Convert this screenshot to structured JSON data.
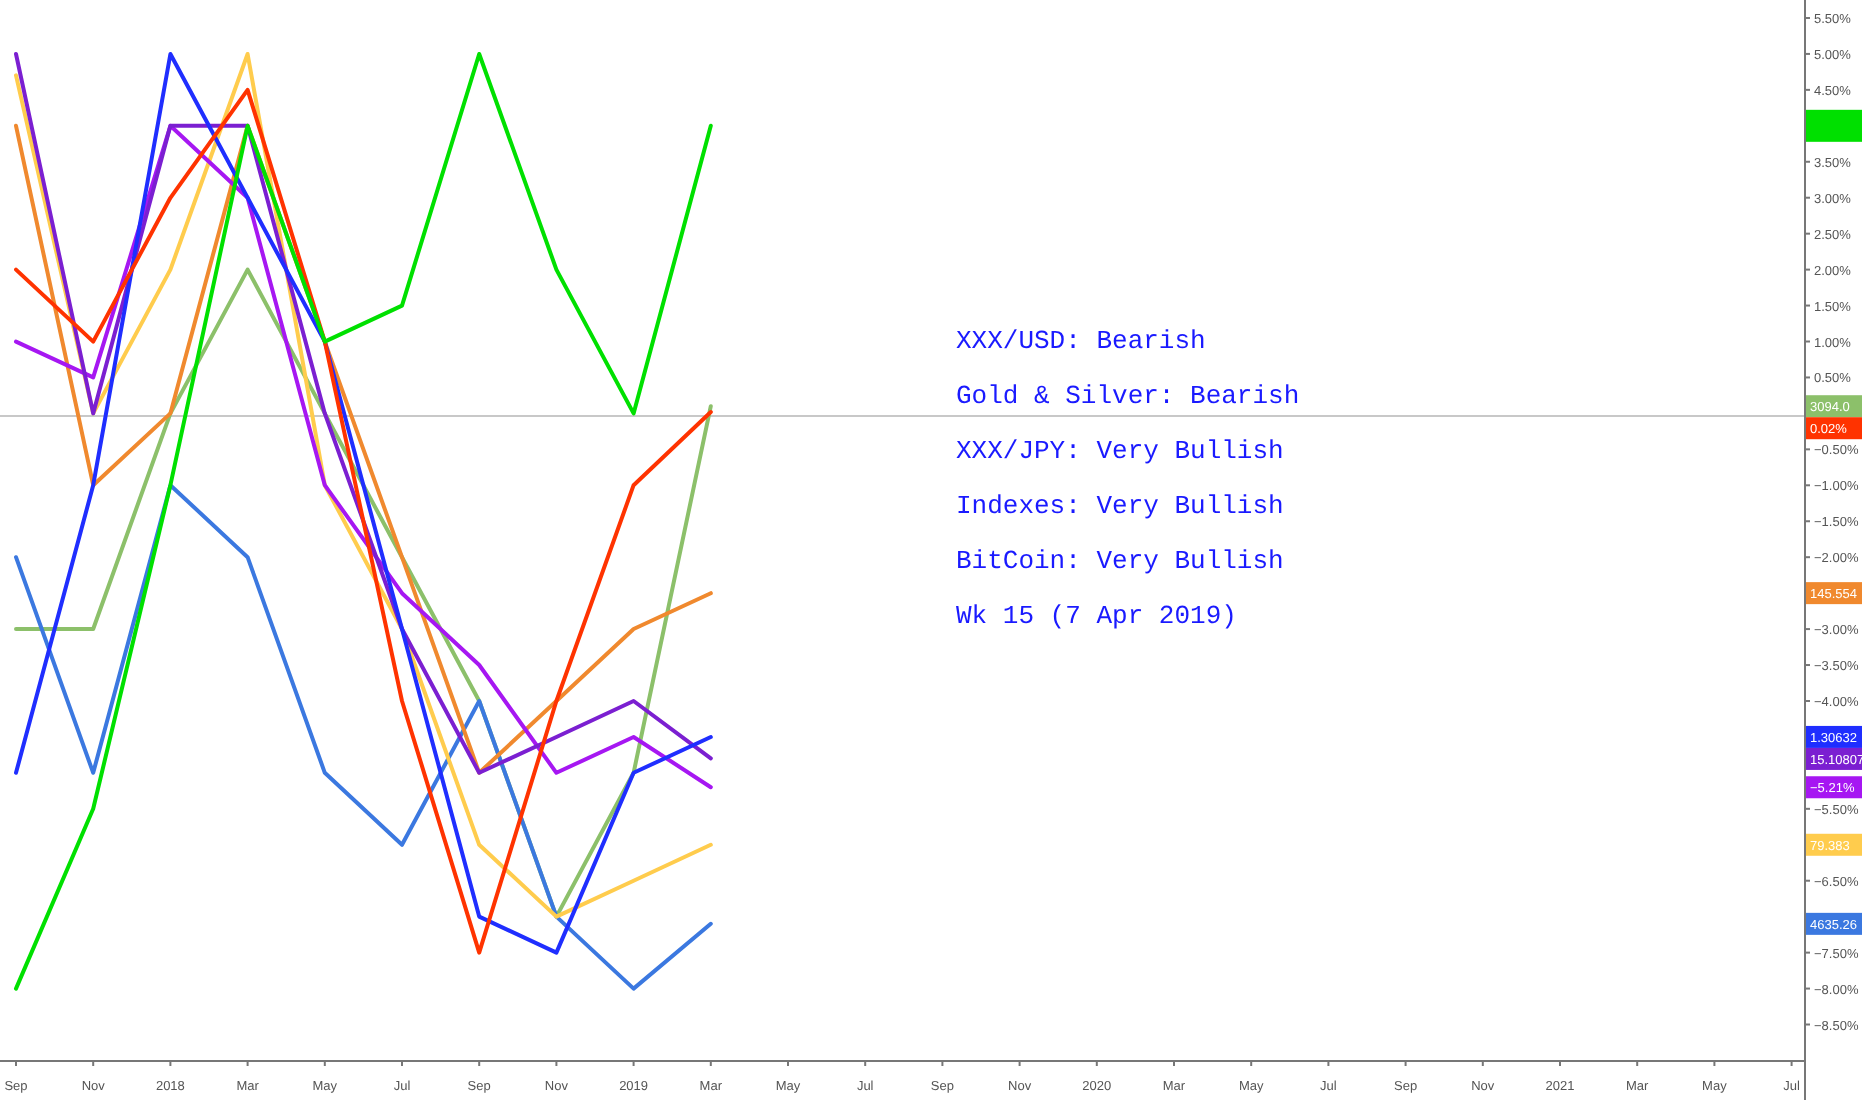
{
  "chart": {
    "notes": [
      "XXX/USD: Bearish",
      "Gold & Silver: Bearish",
      "XXX/JPY: Very Bullish",
      "Indexes: Very Bullish",
      "BitCoin: Very Bullish",
      "Wk 15 (7 Apr 2019)"
    ],
    "price_labels": [
      {
        "color": "#00e000"
      },
      {
        "text": "3094.0",
        "color": "#8cc06a"
      },
      {
        "text": "0.02%",
        "color": "#ff3300"
      },
      {
        "text": "145.554",
        "color": "#f0892e"
      },
      {
        "text": "1.30632",
        "color": "#1f2eff"
      },
      {
        "text": "15.10807",
        "color": "#7b1fd1"
      },
      {
        "text": "−5.21%",
        "color": "#a617f2"
      },
      {
        "text": "79.383",
        "color": "#ffcc4d"
      },
      {
        "text": "4635.26",
        "color": "#3b78e0"
      }
    ],
    "chart_data": {
      "type": "line",
      "categories": [
        "Sep",
        "Nov",
        "2018",
        "Mar",
        "May",
        "Jul",
        "Sep",
        "Nov",
        "2019",
        "Mar",
        "May",
        "Jul",
        "Sep",
        "Nov",
        "2020",
        "Mar",
        "May",
        "Jul",
        "Sep",
        "Nov",
        "2021",
        "Mar",
        "May",
        "Jul"
      ],
      "yticks": [
        {
          "value": 5.5,
          "label": "5.50%"
        },
        {
          "value": 5,
          "label": "5.00%"
        },
        {
          "value": 4.5,
          "label": "4.50%"
        },
        {
          "value": 3.5,
          "label": "3.50%"
        },
        {
          "value": 3,
          "label": "3.00%"
        },
        {
          "value": 2.5,
          "label": "2.50%"
        },
        {
          "value": 2,
          "label": "2.00%"
        },
        {
          "value": 1.5,
          "label": "1.50%"
        },
        {
          "value": 1,
          "label": "1.00%"
        },
        {
          "value": 0.5,
          "label": "0.50%"
        },
        {
          "value": -0.5,
          "label": "−0.50%"
        },
        {
          "value": -1,
          "label": "−1.00%"
        },
        {
          "value": -1.5,
          "label": "−1.50%"
        },
        {
          "value": -2,
          "label": "−2.00%"
        },
        {
          "value": -3,
          "label": "−3.00%"
        },
        {
          "value": -3.5,
          "label": "−3.50%"
        },
        {
          "value": -4,
          "label": "−4.00%"
        },
        {
          "value": -5.5,
          "label": "−5.50%"
        },
        {
          "value": -6.5,
          "label": "−6.50%"
        },
        {
          "value": -7.5,
          "label": "−7.50%"
        },
        {
          "value": -8,
          "label": "−8.00%"
        },
        {
          "value": -8.5,
          "label": "−8.50%"
        }
      ],
      "ylim": [
        -9.55,
        5.75
      ],
      "series": [
        {
          "color": "#8cc06a",
          "values": [
            -3,
            -3,
            0,
            2,
            0,
            -2,
            -4,
            -7,
            -5,
            0.1,
            null,
            null,
            null,
            null,
            null,
            null,
            null,
            null,
            null,
            null,
            null,
            null,
            null,
            null
          ]
        },
        {
          "color": "#3b78e0",
          "values": [
            -2,
            -5,
            -1,
            -2,
            -5,
            -6,
            -4,
            -7,
            -8,
            -7.1,
            null,
            null,
            null,
            null,
            null,
            null,
            null,
            null,
            null,
            null,
            null,
            null,
            null,
            null
          ]
        },
        {
          "color": "#ffcc4d",
          "values": [
            4.7,
            0,
            2,
            5,
            -1,
            -3,
            -6,
            -7,
            -6.5,
            -6,
            null,
            null,
            null,
            null,
            null,
            null,
            null,
            null,
            null,
            null,
            null,
            null,
            null,
            null
          ]
        },
        {
          "color": "#f0892e",
          "values": [
            4,
            -1,
            0,
            4,
            1,
            -2,
            -5,
            -4,
            -3,
            -2.5,
            null,
            null,
            null,
            null,
            null,
            null,
            null,
            null,
            null,
            null,
            null,
            null,
            null,
            null
          ]
        },
        {
          "color": "#a617f2",
          "values": [
            1,
            0.5,
            4,
            3,
            -1,
            -2.5,
            -3.5,
            -5,
            -4.5,
            -5.2,
            null,
            null,
            null,
            null,
            null,
            null,
            null,
            null,
            null,
            null,
            null,
            null,
            null,
            null
          ]
        },
        {
          "color": "#7b1fd1",
          "values": [
            5,
            0,
            4,
            4,
            0,
            -3,
            -5,
            -4.5,
            -4,
            -4.8,
            null,
            null,
            null,
            null,
            null,
            null,
            null,
            null,
            null,
            null,
            null,
            null,
            null,
            null
          ]
        },
        {
          "color": "#1f2eff",
          "values": [
            -5,
            -1,
            5,
            3,
            1,
            -3,
            -7,
            -7.5,
            -5,
            -4.5,
            null,
            null,
            null,
            null,
            null,
            null,
            null,
            null,
            null,
            null,
            null,
            null,
            null,
            null
          ]
        },
        {
          "color": "#ff3300",
          "values": [
            2,
            1,
            3,
            4.5,
            1,
            -4,
            -7.5,
            -4,
            -1,
            0.02,
            null,
            null,
            null,
            null,
            null,
            null,
            null,
            null,
            null,
            null,
            null,
            null,
            null,
            null
          ]
        },
        {
          "color": "#00e000",
          "values": [
            -8,
            -5.5,
            -1,
            4,
            1,
            1.5,
            5,
            2,
            0,
            4,
            null,
            null,
            null,
            null,
            null,
            null,
            null,
            null,
            null,
            null,
            null,
            null,
            null,
            null
          ]
        }
      ]
    }
  }
}
